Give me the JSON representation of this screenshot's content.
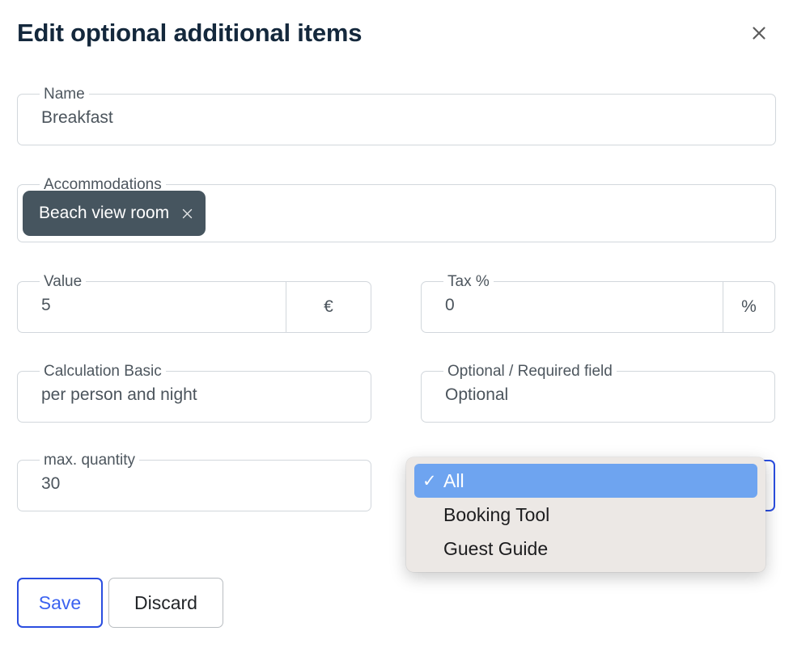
{
  "dialog": {
    "title": "Edit optional additional items",
    "close_label": "×",
    "close_icon": "close-icon"
  },
  "fields": {
    "name": {
      "label": "Name",
      "value": "Breakfast"
    },
    "accommodations": {
      "label": "Accommodations",
      "chips": [
        {
          "label": "Beach view room",
          "delete_icon": "close-icon"
        }
      ]
    },
    "value": {
      "label": "Value",
      "value": "5",
      "adornment": "€"
    },
    "tax": {
      "label": "Tax %",
      "value": "0",
      "adornment": "%"
    },
    "calculation_basic": {
      "label": "Calculation Basic",
      "value": "per person and night"
    },
    "optional_required": {
      "label": "Optional / Required field",
      "value": "Optional"
    },
    "max_quantity": {
      "label": "max. quantity",
      "value": "30"
    },
    "visibility": {
      "label": "",
      "value": "All",
      "focused": true
    }
  },
  "dropdown": {
    "options": [
      {
        "label": "All",
        "selected": true,
        "check": "✓"
      },
      {
        "label": "Booking Tool",
        "selected": false,
        "check": ""
      },
      {
        "label": "Guest Guide",
        "selected": false,
        "check": ""
      }
    ]
  },
  "actions": {
    "save_label": "Save",
    "discard_label": "Discard"
  },
  "colors": {
    "title": "#14283c",
    "accent_blue": "#2b4ee0",
    "chip_bg": "#46555f",
    "highlight_blue": "#6ea4f0",
    "border": "#d2d7dc",
    "popup_bg": "#ece8e5"
  }
}
